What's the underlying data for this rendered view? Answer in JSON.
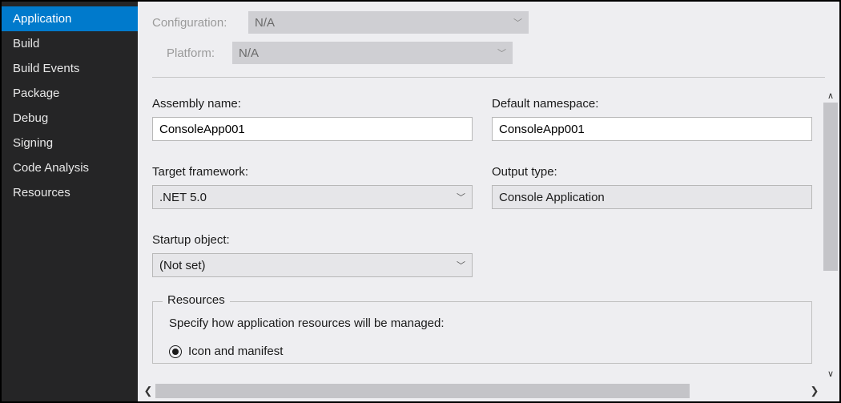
{
  "sidebar": {
    "items": [
      {
        "label": "Application",
        "active": true
      },
      {
        "label": "Build",
        "active": false
      },
      {
        "label": "Build Events",
        "active": false
      },
      {
        "label": "Package",
        "active": false
      },
      {
        "label": "Debug",
        "active": false
      },
      {
        "label": "Signing",
        "active": false
      },
      {
        "label": "Code Analysis",
        "active": false
      },
      {
        "label": "Resources",
        "active": false
      }
    ]
  },
  "topbar": {
    "configuration_label": "Configuration:",
    "configuration_value": "N/A",
    "platform_label": "Platform:",
    "platform_value": "N/A"
  },
  "fields": {
    "assembly_name_label": "Assembly name:",
    "assembly_name_value": "ConsoleApp001",
    "default_namespace_label": "Default namespace:",
    "default_namespace_value": "ConsoleApp001",
    "target_framework_label": "Target framework:",
    "target_framework_value": ".NET 5.0",
    "output_type_label": "Output type:",
    "output_type_value": "Console Application",
    "startup_object_label": "Startup object:",
    "startup_object_value": "(Not set)"
  },
  "resources_group": {
    "legend": "Resources",
    "description": "Specify how application resources will be managed:",
    "option1_label": "Icon and manifest"
  },
  "icons": {
    "chevron_down": "﹀",
    "scroll_up": "∧",
    "scroll_down": "∨",
    "scroll_left": "❮",
    "scroll_right": "❯"
  }
}
